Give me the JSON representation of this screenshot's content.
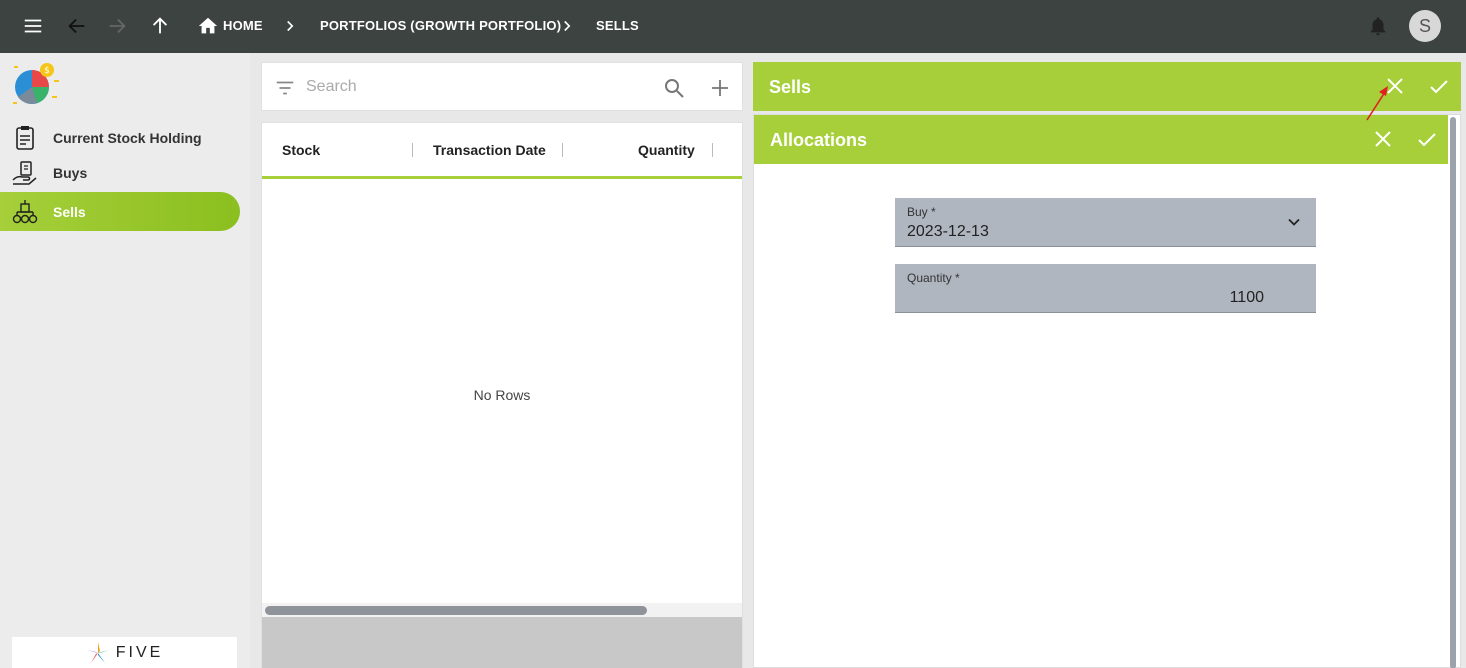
{
  "topbar": {
    "breadcrumbs": [
      "HOME",
      "PORTFOLIOS (GROWTH PORTFOLIO)",
      "SELLS"
    ],
    "avatar_letter": "S"
  },
  "sidebar": {
    "items": [
      {
        "label": "Current Stock Holding",
        "icon": "clipboard-icon"
      },
      {
        "label": "Buys",
        "icon": "hand-money-icon"
      },
      {
        "label": "Sells",
        "icon": "coins-stack-icon",
        "active": true
      }
    ],
    "footer_logo_text": "FIVE"
  },
  "list": {
    "search_placeholder": "Search",
    "columns": [
      "Stock",
      "Transaction Date",
      "Quantity"
    ],
    "empty_text": "No Rows"
  },
  "sells_panel": {
    "title": "Sells"
  },
  "allocations_panel": {
    "title": "Allocations",
    "fields": {
      "buy": {
        "label": "Buy *",
        "value": "2023-12-13"
      },
      "quantity": {
        "label": "Quantity *",
        "value": "1100"
      }
    }
  },
  "colors": {
    "accent": "#a6cf3a",
    "topbar": "#3c4341",
    "annotation_arrow": "#e02020"
  }
}
